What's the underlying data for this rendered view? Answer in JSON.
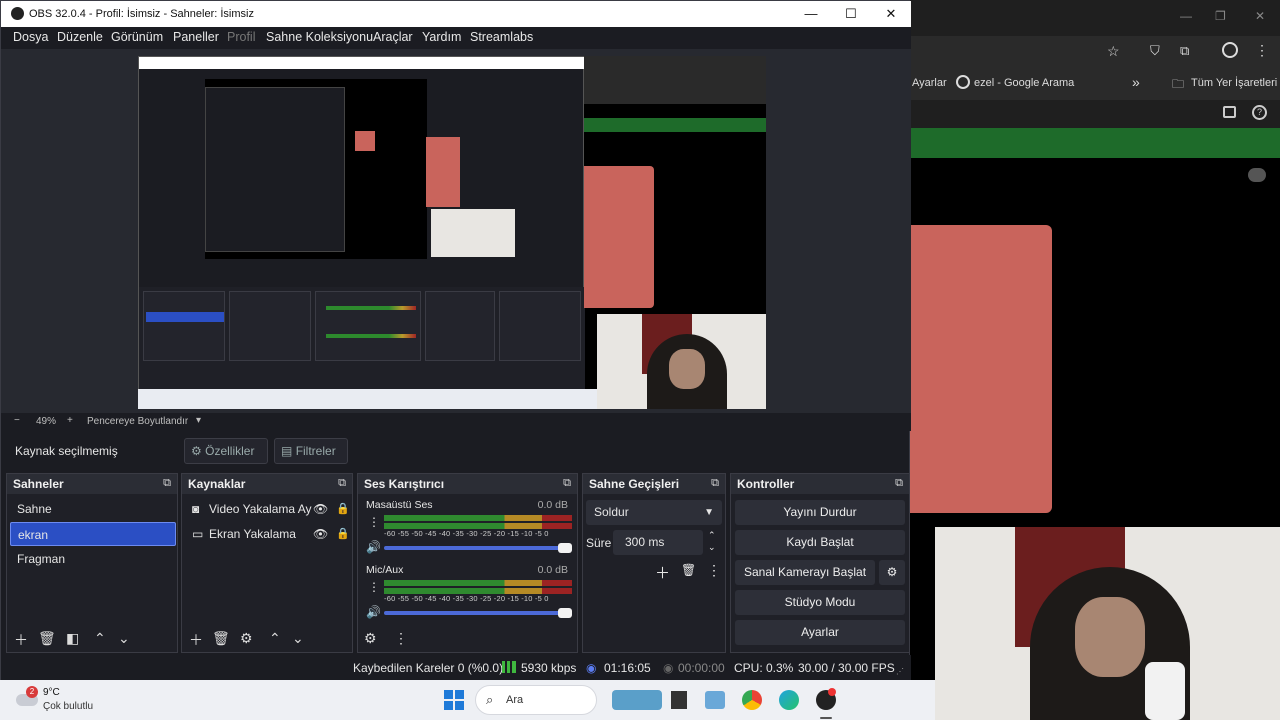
{
  "window": {
    "title": "OBS 32.0.4 - Profil: İsimsiz - Sahneler: İsimsiz",
    "minimize": "—",
    "maximize": "☐",
    "close": "✕"
  },
  "menu": [
    "Dosya",
    "Düzenle",
    "Görünüm",
    "Paneller",
    "Profil",
    "Sahne Koleksiyonu",
    "Araçlar",
    "Yardım",
    "Streamlabs"
  ],
  "preview_bar": {
    "minus": "−",
    "zoom": "49%",
    "plus": "+",
    "fit_label": "Pencereye Boyutlandır",
    "dropdown": "▾"
  },
  "source_toolbar": {
    "status": "Kaynak seçilmemiş",
    "properties": "Özellikler",
    "filters": "Filtreler"
  },
  "scenes": {
    "title": "Sahneler",
    "items": [
      "Sahne",
      "ekran",
      "Fragman"
    ],
    "selected": "ekran"
  },
  "sources": {
    "title": "Kaynaklar",
    "items": [
      "Video Yakalama Ay",
      "Ekran Yakalama"
    ]
  },
  "mixer": {
    "title": "Ses Karıştırıcı",
    "channels": [
      {
        "name": "Masaüstü Ses",
        "db": "0.0 dB"
      },
      {
        "name": "Mic/Aux",
        "db": "0.0 dB"
      }
    ],
    "ticks": "-60 -55 -50 -45 -40 -35 -30 -25 -20 -15 -10 -5 0"
  },
  "transitions": {
    "title": "Sahne Geçişleri",
    "type": "Soldur",
    "duration_label": "Süre",
    "duration": "300 ms"
  },
  "controls": {
    "title": "Kontroller",
    "buttons": [
      "Yayını Durdur",
      "Kaydı Başlat",
      "Sanal Kamerayı Başlat",
      "Stüdyo Modu",
      "Ayarlar"
    ]
  },
  "status": {
    "dropped": "Kaybedilen Kareler 0 (%0.0)",
    "bitrate": "5930 kbps",
    "stream_time": "01:16:05",
    "rec_time": "00:00:00",
    "cpu": "CPU: 0.3%",
    "fps": "30.00 / 30.00 FPS"
  },
  "browser": {
    "bookmark1": "Ayarlar",
    "bookmark2": "ezel - Google Arama",
    "bookmark3": "Tüm Yer İşaretleri",
    "more": "»"
  },
  "taskbar": {
    "weather_badge": "2",
    "temp": "9°C",
    "weather": "Çok bulutlu",
    "search": "Ara"
  },
  "colors": {
    "accent": "#2b4fc4",
    "obs_bg": "#1b1c22",
    "pink": "#c9645c",
    "green": "#1e6b2a"
  }
}
